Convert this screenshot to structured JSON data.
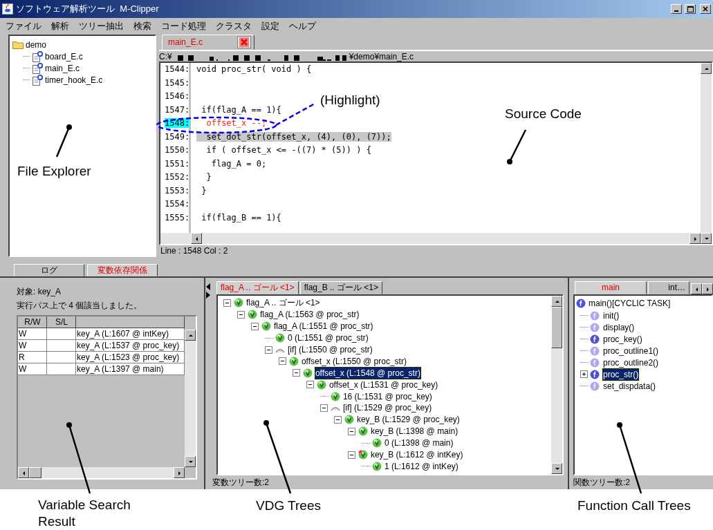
{
  "window": {
    "title": "ソフトウェア解析ツール  M-Clipper"
  },
  "menu": [
    "ファイル",
    "解析",
    "ツリー抽出",
    "検索",
    "コード処理",
    "クラスタ",
    "設定",
    "ヘルプ"
  ],
  "file_explorer": {
    "tree": [
      {
        "label": "demo",
        "kind": "folder",
        "children": [
          {
            "label": "board_E.c",
            "kind": "file"
          },
          {
            "label": "main_E.c",
            "kind": "file"
          },
          {
            "label": "timer_hook_E.c",
            "kind": "file"
          }
        ]
      }
    ]
  },
  "editor": {
    "tabs": [
      {
        "label": "main_E.c",
        "selected": true
      }
    ],
    "path_start": "C:¥",
    "path_end": "¥demo¥main_E.c",
    "lines": [
      {
        "number": "1544:",
        "code": "void proc_str( void ) {",
        "kind": "normal"
      },
      {
        "number": "1545:",
        "kind": "normal"
      },
      {
        "number": "1546:",
        "kind": "normal"
      },
      {
        "number": "1547:",
        "code": " if(flag_A == 1){",
        "kind": "normal"
      },
      {
        "number": "1548:",
        "code": "  offset_x --;",
        "kind": "current"
      },
      {
        "number": "1549:",
        "code": "  set_dot_str(offset_x, (4), (0), (7));",
        "kind": "shaded"
      },
      {
        "number": "1550:",
        "code": "  if ( offset_x <= -((7) * (5)) ) {",
        "kind": "normal"
      },
      {
        "number": "1551:",
        "code": "   flag_A = 0;",
        "kind": "normal"
      },
      {
        "number": "1552:",
        "code": "  }",
        "kind": "normal"
      },
      {
        "number": "1553:",
        "code": " }",
        "kind": "normal"
      },
      {
        "number": "1554:",
        "kind": "normal"
      },
      {
        "number": "1555:",
        "code": " if(flag_B == 1){",
        "kind": "normal"
      }
    ],
    "status": "Line : 1548  Col : 2"
  },
  "bottom_tabs": [
    {
      "label": "ログ",
      "selected": false
    },
    {
      "label": "変数依存関係",
      "selected": true
    }
  ],
  "variable_search": {
    "target": "対象: key_A",
    "summary": "実行パス上で 4 個該当しました。",
    "columns": [
      "R/W",
      "S/L"
    ],
    "rows": [
      {
        "rw": "W",
        "item": "key_A (L:1607 @ intKey)"
      },
      {
        "rw": "W",
        "item": "key_A (L:1537 @ proc_key)"
      },
      {
        "rw": "R",
        "item": "key_A (L:1523 @ proc_key)"
      },
      {
        "rw": "W",
        "item": "key_A (L:1397 @ main)"
      }
    ]
  },
  "vdg": {
    "tabs": [
      {
        "label": "flag_A .. ゴール <1>",
        "selected": true
      },
      {
        "label": "flag_B .. ゴール <1>",
        "selected": false
      }
    ],
    "tree": {
      "label": "flag_A .. ゴール <1>",
      "kind": "v",
      "selected": false,
      "expanded": true,
      "children": [
        {
          "label": "flag_A (L:1563 @ proc_str)",
          "kind": "v",
          "selected": false,
          "expanded": true,
          "children": [
            {
              "label": "flag_A (L:1551 @ proc_str)",
              "kind": "v",
              "selected": false,
              "expanded": true,
              "children": [
                {
                  "label": "0 (L:1551 @ proc_str)",
                  "kind": "v",
                  "selected": false
                },
                {
                  "label": "[if] (L:1550 @ proc_str)",
                  "kind": "if",
                  "selected": false,
                  "expanded": true,
                  "children": [
                    {
                      "label": "offset_x (L:1550 @ proc_str)",
                      "kind": "v",
                      "selected": false,
                      "expanded": true,
                      "children": [
                        {
                          "label": "offset_x (L:1548 @ proc_str)",
                          "kind": "v",
                          "selected": true,
                          "expanded": true,
                          "children": [
                            {
                              "label": "offset_x (L:1531 @ proc_key)",
                              "kind": "v",
                              "selected": false,
                              "expanded": true,
                              "children": [
                                {
                                  "label": "16 (L:1531 @ proc_key)",
                                  "kind": "v",
                                  "selected": false
                                },
                                {
                                  "label": "[if] (L:1529 @ proc_key)",
                                  "kind": "if",
                                  "selected": false,
                                  "expanded": true,
                                  "children": [
                                    {
                                      "label": "key_B (L:1529 @ proc_key)",
                                      "kind": "v",
                                      "selected": false,
                                      "expanded": true,
                                      "children": [
                                        {
                                          "label": "key_B (L:1398 @ main)",
                                          "kind": "v",
                                          "selected": false,
                                          "expanded": true,
                                          "children": [
                                            {
                                              "label": "0 (L:1398 @ main)",
                                              "kind": "v",
                                              "selected": false
                                            }
                                          ]
                                        },
                                        {
                                          "label": "key_B (L:1612 @ intKey)",
                                          "kind": "v_flagged",
                                          "selected": false,
                                          "expanded": true,
                                          "children": [
                                            {
                                              "label": "1 (L:1612 @ intKey)",
                                              "kind": "v",
                                              "selected": false
                                            }
                                          ]
                                        }
                                      ]
                                    }
                                  ]
                                }
                              ]
                            }
                          ]
                        }
                      ]
                    }
                  ]
                }
              ]
            }
          ]
        }
      ]
    },
    "status": "変数ツリー数:2"
  },
  "function_calls": {
    "tabs": [
      {
        "label": "main",
        "selected": true
      },
      {
        "label": "int…",
        "selected": false
      }
    ],
    "tree": {
      "label": "main()[CYCLIC TASK]",
      "active": true,
      "children": [
        {
          "label": "init()",
          "active": false,
          "has_children": false,
          "selected": false
        },
        {
          "label": "display()",
          "active": false,
          "has_children": false,
          "selected": false
        },
        {
          "label": "proc_key()",
          "active": true,
          "has_children": false,
          "selected": false
        },
        {
          "label": "proc_outline1()",
          "active": false,
          "has_children": false,
          "selected": false
        },
        {
          "label": "proc_outline2()",
          "active": false,
          "has_children": false,
          "selected": false
        },
        {
          "label": "proc_str()",
          "active": true,
          "has_children": true,
          "selected": true
        },
        {
          "label": "set_dispdata()",
          "active": false,
          "has_children": false,
          "selected": false
        }
      ]
    },
    "status": "関数ツリー数:2"
  },
  "annotations": [
    "File Explorer",
    "Source Code",
    "(Highlight)",
    "Variable Search Result",
    "VDG Trees",
    "Function Call Trees"
  ]
}
